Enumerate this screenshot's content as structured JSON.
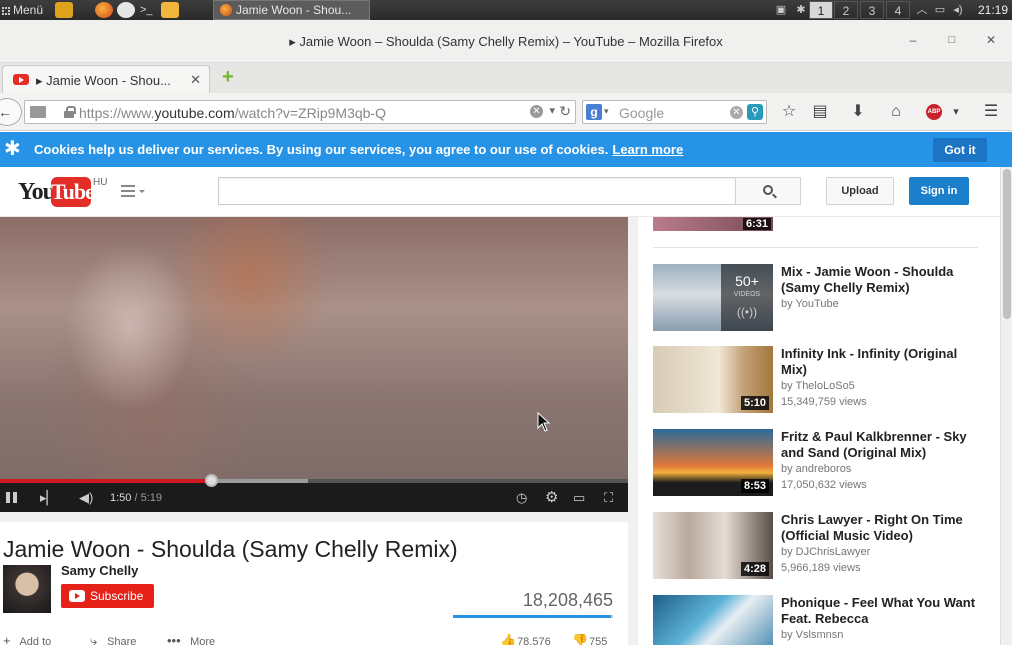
{
  "panel": {
    "menu_label": "Menü",
    "task_label": "Jamie Woon - Shou...",
    "workspaces": [
      "1",
      "2",
      "3",
      "4"
    ],
    "clock": "21:19"
  },
  "window": {
    "title": "▸ Jamie Woon – Shoulda (Samy Chelly Remix) – YouTube – Mozilla Firefox",
    "minimize": "–",
    "maximize": "□",
    "close": "✕"
  },
  "tab": {
    "label": "▸ Jamie Woon - Shou...",
    "close": "✕",
    "new_tab": "+"
  },
  "nav": {
    "url_prefix": "https://www.",
    "url_domain": "youtube.com",
    "url_path": "/watch?v=ZRip9M3qb-Q",
    "search_engine_letter": "g",
    "search_placeholder": "Google",
    "abp_label": "ABP"
  },
  "cookie": {
    "message": "Cookies help us deliver our services. By using our services, you agree to our use of cookies.",
    "link": "Learn more",
    "button": "Got it"
  },
  "masthead": {
    "logo_you": "You",
    "logo_tube": "Tube",
    "region": "HU",
    "upload": "Upload",
    "sign_in": "Sign in"
  },
  "player": {
    "current_time": "1:50",
    "duration": "5:19",
    "played_fraction": 0.3354,
    "buffered_fraction": 0.49
  },
  "video": {
    "title": "Jamie Woon - Shoulda (Samy Chelly Remix)",
    "channel": "Samy Chelly",
    "subscribe": "Subscribe",
    "views": "18,208,465",
    "likes": "78,576",
    "dislikes": "755",
    "like_fraction": 0.99,
    "add_to": "Add to",
    "share": "Share",
    "more": "More"
  },
  "sidebar": {
    "top_duration": "6:31",
    "items": [
      {
        "title": "Mix - Jamie Woon - Shoulda (Samy Chelly Remix)",
        "by": "by YouTube",
        "views": "",
        "duration": "",
        "mix_count": "50+",
        "mix_sub": "VIDEOS"
      },
      {
        "title": "Infinity Ink - Infinity (Original Mix)",
        "by": "by TheloLoSo5",
        "views": "15,349,759 views",
        "duration": "5:10"
      },
      {
        "title": "Fritz & Paul Kalkbrenner - Sky and Sand (Original Mix)",
        "by": "by andreboros",
        "views": "17,050,632 views",
        "duration": "8:53"
      },
      {
        "title": "Chris Lawyer - Right On Time (Official Music Video)",
        "by": "by DJChrisLawyer",
        "views": "5,966,189 views",
        "duration": "4:28"
      },
      {
        "title": "Phonique - Feel What You Want Feat. Rebecca",
        "by": "by Vslsmnsn",
        "views": "",
        "duration": ""
      }
    ]
  }
}
